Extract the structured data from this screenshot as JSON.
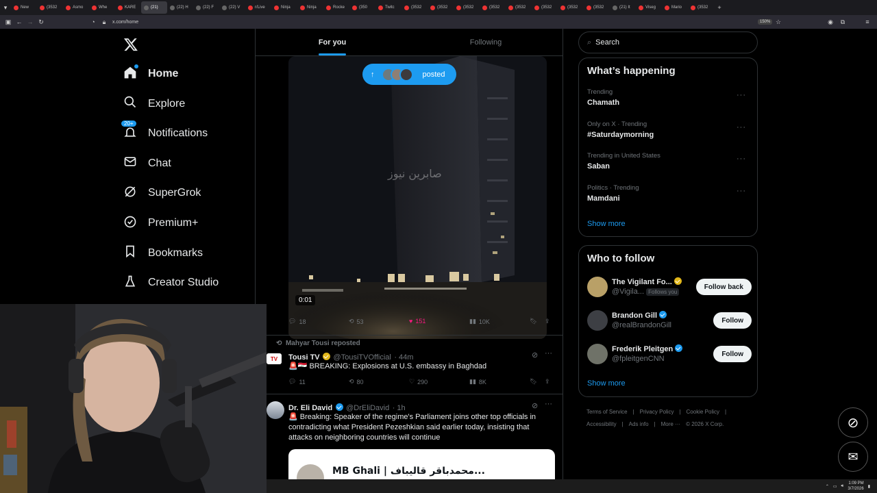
{
  "browser": {
    "tabs": [
      "New",
      "(3532",
      "Asmo",
      "Whe",
      "KARE",
      "(21)",
      "(22) H",
      "(22) F",
      "(22) V",
      "r/Live",
      "Ninja",
      "Ninja",
      "Rocke",
      "(350",
      "Twitc",
      "(3532",
      "(3532",
      "(3532",
      "(3532",
      "(3532",
      "(3532",
      "(3532",
      "(3532",
      "(21) It",
      "Viseg",
      "Mario",
      "(3532"
    ],
    "url": "x.com/home",
    "zoom": "150%"
  },
  "nav": {
    "items": [
      {
        "label": "Home",
        "icon": "home-icon"
      },
      {
        "label": "Explore",
        "icon": "search-icon"
      },
      {
        "label": "Notifications",
        "icon": "bell-icon",
        "badge": "20+"
      },
      {
        "label": "Chat",
        "icon": "mail-icon"
      },
      {
        "label": "SuperGrok",
        "icon": "grok-icon"
      },
      {
        "label": "Premium+",
        "icon": "verified-icon"
      },
      {
        "label": "Bookmarks",
        "icon": "bookmark-icon"
      },
      {
        "label": "Creator Studio",
        "icon": "flask-icon"
      }
    ]
  },
  "feed": {
    "tabs": [
      "For you",
      "Following"
    ],
    "pill_label": "posted",
    "video_watermark": "صابرين نيوز",
    "video_time": "0:01",
    "post1_stats": {
      "replies": "18",
      "reposts": "53",
      "likes": "151",
      "views": "10K"
    },
    "post2": {
      "repost_by": "Mahyar Tousi reposted",
      "name": "Tousi TV",
      "handle": "@TousiTVOfficial",
      "time": "· 44m",
      "text": "🚨🇮🇶 BREAKING: Explosions at U.S. embassy in Baghdad",
      "stats": {
        "replies": "11",
        "reposts": "80",
        "likes": "290",
        "views": "8K"
      }
    },
    "post3": {
      "name": "Dr. Eli David",
      "handle": "@DrEliDavid",
      "time": "· 1h",
      "text": "🚨 Breaking: Speaker of the regime's Parliament joins other top officials in contradicting what President Pezeshkian said earlier today, insisting that attacks on neighboring countries will continue",
      "embed_text": "MB Ghali | محمدباقر قالیباف..."
    }
  },
  "sidebar": {
    "search_placeholder": "Search",
    "happening_title": "What’s happening",
    "trends": [
      {
        "category": "Trending",
        "title": "Chamath"
      },
      {
        "category": "Only on X · Trending",
        "title": "#Saturdaymorning"
      },
      {
        "category": "Trending in United States",
        "title": "Saban"
      },
      {
        "category": "Politics · Trending",
        "title": "Mamdani"
      }
    ],
    "show_more": "Show more",
    "wtf_title": "Who to follow",
    "follow": [
      {
        "name": "The Vigilant Fo...",
        "handle": "@Vigila...",
        "follows_you": "Follows you",
        "button": "Follow back",
        "badge": "gold"
      },
      {
        "name": "Brandon Gill",
        "handle": "@realBrandonGill",
        "button": "Follow",
        "badge": "blue"
      },
      {
        "name": "Frederik Pleitgen",
        "handle": "@fpleitgenCNN",
        "button": "Follow",
        "badge": "blue"
      }
    ],
    "show_more2": "Show more",
    "footer_line1": [
      "Terms of Service",
      "|",
      "Privacy Policy",
      "|",
      "Cookie Policy",
      "|"
    ],
    "footer_line2": [
      "Accessibility",
      "|",
      "Ads info",
      "|",
      "More ···",
      "© 2026 X Corp."
    ]
  },
  "taskbar": {
    "time": "1:09 PM",
    "date": "3/7/2026"
  }
}
